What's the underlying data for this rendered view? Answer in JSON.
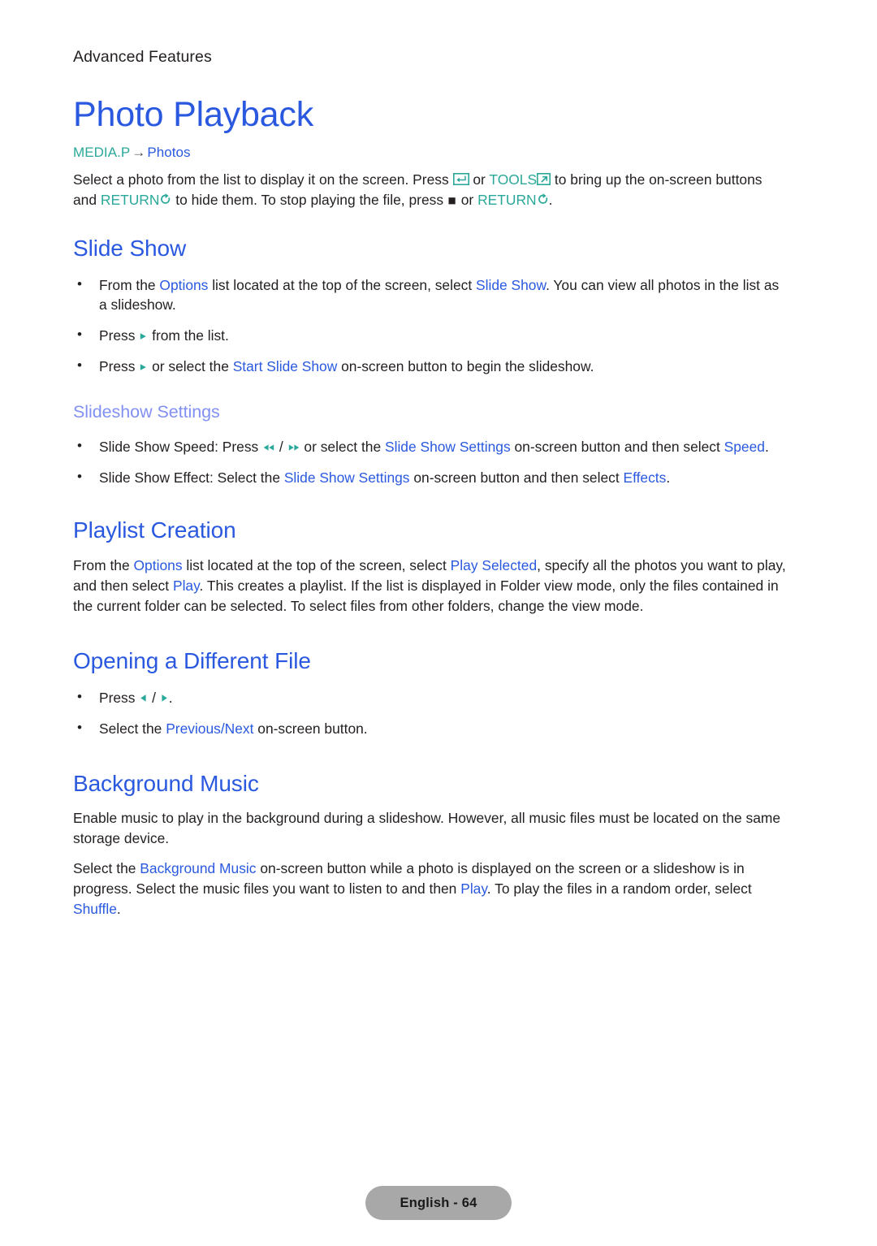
{
  "header": {
    "running_head": "Advanced Features"
  },
  "title": "Photo Playback",
  "breadcrumb": {
    "root": "MEDIA.P",
    "arrow": "→",
    "leaf": "Photos"
  },
  "intro": {
    "t1": "Select a photo from the list to display it on the screen. Press ",
    "icon_enter": "enter-key-icon",
    "t2": " or ",
    "tools_label": "TOOLS",
    "icon_tools": "tools-key-icon",
    "t3": " to bring up the on-screen buttons and ",
    "return_label_1": "RETURN",
    "icon_return_1": "return-key-icon",
    "t4": " to hide them. To stop playing the file, press ",
    "icon_stop": "stop-key-icon",
    "t5": " or ",
    "return_label_2": "RETURN",
    "icon_return_2": "return-key-icon",
    "t6": "."
  },
  "sections": {
    "slide_show": {
      "heading": "Slide Show",
      "bullets": [
        {
          "t1": "From the ",
          "ui1": "Options",
          "t2": " list located at the top of the screen, select ",
          "ui2": "Slide Show",
          "t3": ". You can view all photos in the list as a slideshow."
        },
        {
          "t1": "Press ",
          "icon": "play-key-icon",
          "t2": " from the list."
        },
        {
          "t1": "Press ",
          "icon": "play-key-icon",
          "t2": " or select the ",
          "ui1": "Start Slide Show",
          "t3": " on-screen button to begin the slideshow."
        }
      ],
      "subsection": {
        "heading": "Slideshow Settings",
        "bullets": [
          {
            "t1": "Slide Show Speed: Press ",
            "icon_rewind": "rewind-key-icon",
            "t2": " / ",
            "icon_forward": "fast-forward-key-icon",
            "t3": " or select the ",
            "ui1": "Slide Show Settings",
            "t4": " on-screen button and then select ",
            "ui2": "Speed",
            "t5": "."
          },
          {
            "t1": "Slide Show Effect: Select the ",
            "ui1": "Slide Show Settings",
            "t2": " on-screen button and then select ",
            "ui2": "Effects",
            "t3": "."
          }
        ]
      }
    },
    "playlist_creation": {
      "heading": "Playlist Creation",
      "paragraph": {
        "t1": "From the ",
        "ui1": "Options",
        "t2": " list located at the top of the screen, select ",
        "ui2": "Play Selected",
        "t3": ", specify all the photos you want to play, and then select ",
        "ui3": "Play",
        "t4": ". This creates a playlist. If the list is displayed in Folder view mode, only the files contained in the current folder can be selected. To select files from other folders, change the view mode."
      }
    },
    "opening_different_file": {
      "heading": "Opening a Different File",
      "bullets": [
        {
          "t1": "Press ",
          "icon_left": "left-arrow-key-icon",
          "t2": " / ",
          "icon_right": "right-arrow-key-icon",
          "t3": "."
        },
        {
          "t1": "Select the ",
          "ui1": "Previous/Next",
          "t2": " on-screen button."
        }
      ]
    },
    "background_music": {
      "heading": "Background Music",
      "paragraph_1": "Enable music to play in the background during a slideshow. However, all music files must be located on the same storage device.",
      "paragraph_2": {
        "t1": "Select the ",
        "ui1": "Background Music",
        "t2": " on-screen button while a photo is displayed on the screen or a slideshow is in progress. Select the music files you want to listen to and then ",
        "ui2": "Play",
        "t3": ". To play the files in a random order, select ",
        "ui3": "Shuffle",
        "t4": "."
      }
    }
  },
  "footer": {
    "label": "English - 64"
  },
  "colors": {
    "title_blue": "#2a59e0",
    "link_blue": "#2a59e0",
    "subsection_blue": "#8190f2",
    "teal": "#2aa89a",
    "body_text": "#231f20",
    "footer_pill_bg": "#a8a8a8"
  }
}
